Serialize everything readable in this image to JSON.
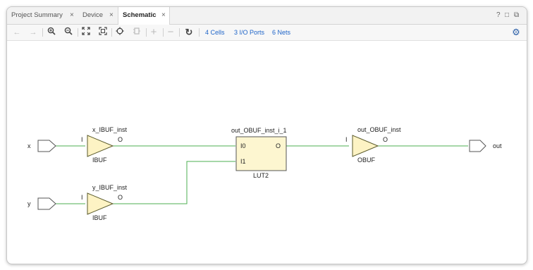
{
  "tabs": [
    {
      "label": "Project Summary",
      "close": "×",
      "active": false
    },
    {
      "label": "Device",
      "close": "×",
      "active": false
    },
    {
      "label": "Schematic",
      "close": "×",
      "active": true
    }
  ],
  "window_controls": {
    "help": "?",
    "restore": "□",
    "float": "⧉"
  },
  "toolbar": {
    "icons": [
      "back-arrow-icon",
      "forward-arrow-icon",
      "zoom-in-icon",
      "zoom-out-icon",
      "fit-full-icon",
      "fit-selection-icon",
      "crosshair-icon",
      "regenerate-icon",
      "expand-icon",
      "collapse-icon",
      "refresh-icon",
      "gear-icon"
    ],
    "cells_label": "4 Cells",
    "ports_label": "3 I/O Ports",
    "nets_label": "6 Nets"
  },
  "schematic": {
    "ports_in": [
      "x",
      "y"
    ],
    "port_out": "out",
    "cells": {
      "x_ibuf": {
        "name": "x_IBUF_inst",
        "type": "IBUF",
        "pin_in": "I",
        "pin_out": "O"
      },
      "y_ibuf": {
        "name": "y_IBUF_inst",
        "type": "IBUF",
        "pin_in": "I",
        "pin_out": "O"
      },
      "lut": {
        "name": "out_OBUF_inst_i_1",
        "type": "LUT2",
        "pin_in0": "I0",
        "pin_in1": "I1",
        "pin_out": "O"
      },
      "obuf": {
        "name": "out_OBUF_inst",
        "type": "OBUF",
        "pin_in": "I",
        "pin_out": "O"
      }
    },
    "colors": {
      "buffer_fill": "#fdf3c4",
      "buffer_stroke": "#5a5a2a",
      "wire": "#4caf50",
      "lut_fill": "#fdf6d0"
    }
  }
}
